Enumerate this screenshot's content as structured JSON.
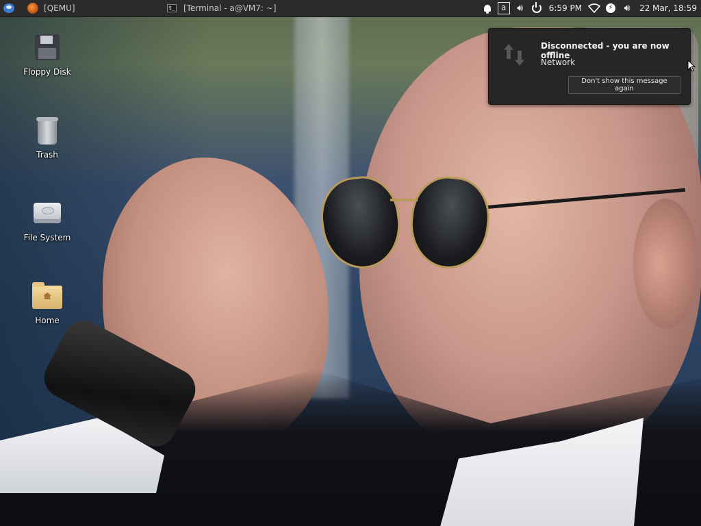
{
  "panel": {
    "tasks": [
      {
        "label": "[QEMU]",
        "icon": "qemu-app-icon"
      },
      {
        "label": "[Terminal - a@VM7: ~]",
        "icon": "terminal-icon"
      }
    ],
    "tray": {
      "keyboard_layout": "a",
      "battery_time": "6:59 PM",
      "clock": "22 Mar, 18:59",
      "icons": [
        "notification-bell-icon",
        "keyboard-layout-icon",
        "volume-icon",
        "power-icon",
        "wifi-icon",
        "power-manager-icon",
        "volume-icon"
      ]
    }
  },
  "desktop": {
    "icons": [
      {
        "label": "Floppy Disk",
        "icon": "floppy-disk-icon"
      },
      {
        "label": "Trash",
        "icon": "trash-icon"
      },
      {
        "label": "File System",
        "icon": "hard-drive-icon"
      },
      {
        "label": "Home",
        "icon": "home-folder-icon"
      }
    ]
  },
  "notification": {
    "title": "Disconnected - you are now offline",
    "body": "Network",
    "button": "Don't show this message again",
    "icon": "network-offline-icon"
  },
  "colors": {
    "panel_bg": "#2b2b2b",
    "notification_bg": "#262626",
    "text": "#ffffff"
  }
}
